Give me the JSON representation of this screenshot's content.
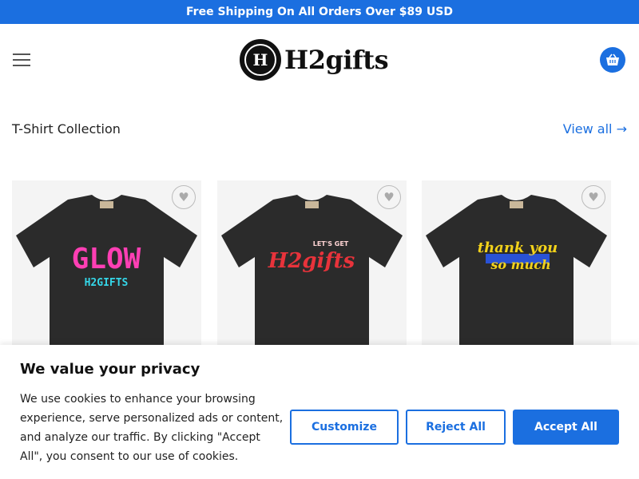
{
  "banner": {
    "text": "Free Shipping On All Orders Over $89 USD"
  },
  "header": {
    "logo_mark": "H",
    "logo_text": "H2gifts"
  },
  "section": {
    "title": "T-Shirt Collection",
    "view_all": "View all →"
  },
  "products": [
    {
      "print_main": "GLOW",
      "print_sub": "H2GIFTS",
      "shirt_color": "#2b2b2b"
    },
    {
      "print_top": "LET'S GET",
      "print_main": "H2gifts",
      "shirt_color": "#2b2b2b"
    },
    {
      "print_line1": "thank you",
      "print_line2": "so much",
      "shirt_color": "#2b2b2b"
    }
  ],
  "cookie": {
    "title": "We value your privacy",
    "body": "We use cookies to enhance your browsing experience, serve personalized ads or content, and analyze our traffic. By clicking \"Accept All\", you consent to our use of cookies.",
    "customize": "Customize",
    "reject": "Reject All",
    "accept": "Accept All"
  },
  "colors": {
    "accent": "#1b6fe0"
  }
}
